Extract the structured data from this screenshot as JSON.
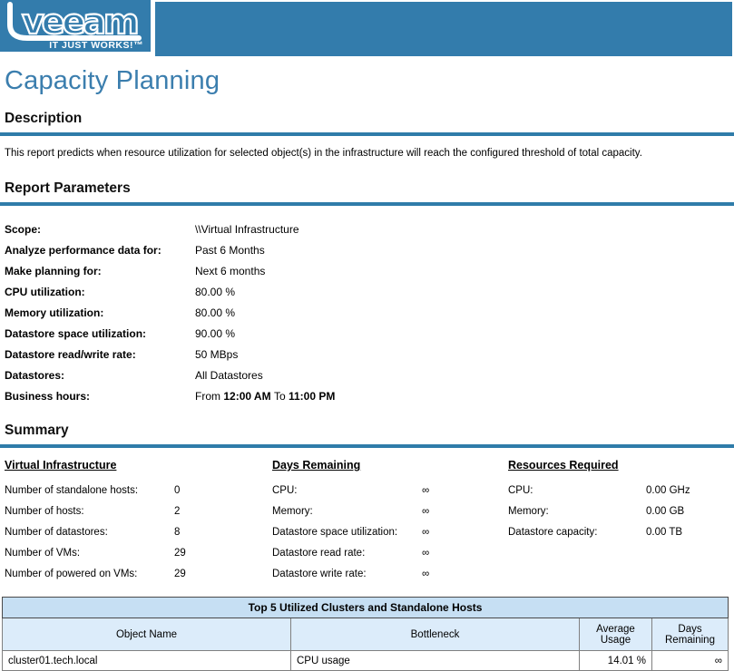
{
  "colors": {
    "banner_blue": "#337CAC",
    "title_blue": "#3B7EAE",
    "rule_blue": "#2F7CA9",
    "table_title_bg": "#C6DFF3",
    "table_header_bg": "#DCECFA",
    "border_dark": "#4A4A4A",
    "border_gray": "#808080"
  },
  "header": {
    "logo_text": "veeam",
    "tagline": "IT JUST WORKS!™"
  },
  "page": {
    "title": "Capacity Planning"
  },
  "description": {
    "heading": "Description",
    "text": "This report predicts when resource utilization for selected object(s) in the infrastructure will reach the configured threshold of total capacity."
  },
  "report_parameters": {
    "heading": "Report Parameters",
    "rows": [
      {
        "label": "Scope:",
        "value": "\\\\Virtual Infrastructure"
      },
      {
        "label": "Analyze performance data for:",
        "value": "Past 6 Months"
      },
      {
        "label": "Make planning for:",
        "value": "Next 6 months"
      },
      {
        "label": "CPU utilization:",
        "value": "80.00 %"
      },
      {
        "label": "Memory utilization:",
        "value": "80.00 %"
      },
      {
        "label": "Datastore space utilization:",
        "value": "90.00 %"
      },
      {
        "label": "Datastore read/write rate:",
        "value": "50 MBps"
      },
      {
        "label": "Datastores:",
        "value": "All Datastores"
      }
    ],
    "business_hours": {
      "label": "Business hours:",
      "from_word": "From",
      "start_time": "12:00 AM",
      "to_word": "To",
      "end_time": "11:00 PM"
    }
  },
  "summary": {
    "heading": "Summary",
    "columns": [
      {
        "heading": "Virtual Infrastructure",
        "rows": [
          {
            "label": "Number of standalone hosts:",
            "value": "0"
          },
          {
            "label": "Number of hosts:",
            "value": "2"
          },
          {
            "label": "Number of datastores:",
            "value": "8"
          },
          {
            "label": "Number of VMs:",
            "value": "29"
          },
          {
            "label": "Number of powered on VMs:",
            "value": "29"
          }
        ]
      },
      {
        "heading": "Days Remaining",
        "rows": [
          {
            "label": "CPU:",
            "value": "∞"
          },
          {
            "label": "Memory:",
            "value": "∞"
          },
          {
            "label": "Datastore space utilization:",
            "value": "∞"
          },
          {
            "label": "Datastore read rate:",
            "value": "∞"
          },
          {
            "label": "Datastore write rate:",
            "value": "∞"
          }
        ]
      },
      {
        "heading": "Resources Required",
        "rows": [
          {
            "label": "CPU:",
            "value": "0.00 GHz"
          },
          {
            "label": "Memory:",
            "value": "0.00 GB"
          },
          {
            "label": "Datastore capacity:",
            "value": "0.00 TB"
          }
        ]
      }
    ]
  },
  "top5_table": {
    "title": "Top 5 Utilized Clusters and Standalone Hosts",
    "columns": [
      "Object Name",
      "Bottleneck",
      "Average Usage",
      "Days Remaining"
    ],
    "rows": [
      [
        "cluster01.tech.local",
        "CPU usage",
        "14.01 %",
        "∞"
      ]
    ]
  }
}
